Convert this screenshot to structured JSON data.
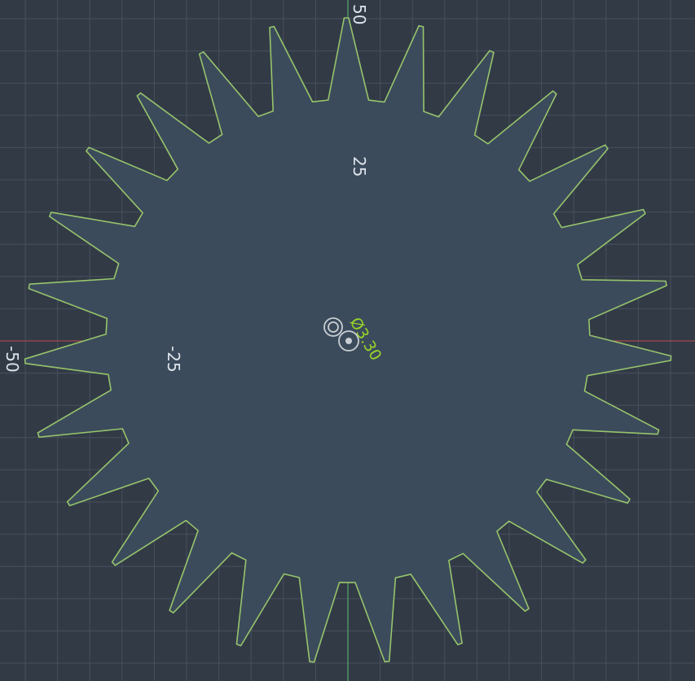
{
  "colors": {
    "background": "#323a46",
    "grid": "#46505c",
    "x_axis": "#c0494f",
    "y_axis": "#5fbf6a",
    "gear_fill": "#3c4b5b",
    "gear_stroke": "#96c46c",
    "dimension_text": "#98d629",
    "label_text": "#dde3ea"
  },
  "axis_labels": {
    "y_top": "50",
    "y_mid": "25",
    "x_left": "-50",
    "x_mid": "-25"
  },
  "dimension": {
    "label": "Ø3.30"
  },
  "gear": {
    "teeth": 27
  },
  "icons": {
    "origin_marker": "concentric-circle-icon",
    "center_snap": "target-icon"
  }
}
